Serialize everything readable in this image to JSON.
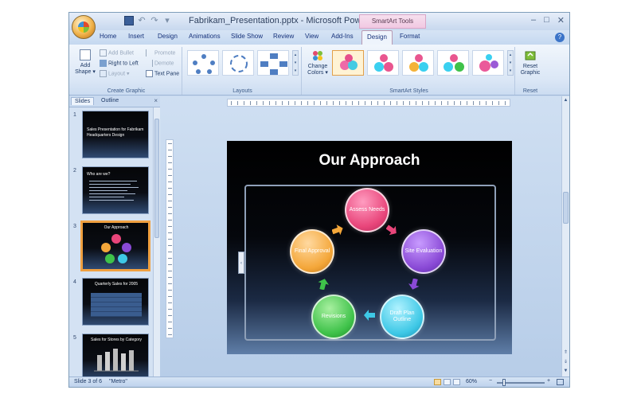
{
  "app": {
    "title": "Fabrikam_Presentation.pptx - Microsoft PowerPoint",
    "contextual_label": "SmartArt Tools"
  },
  "qat": {
    "undo": "↶",
    "redo": "↷",
    "more": "▾"
  },
  "window_controls": {
    "minimize": "–",
    "maximize": "□",
    "close": "✕"
  },
  "tabs": [
    {
      "label": "Home"
    },
    {
      "label": "Insert"
    },
    {
      "label": "Design"
    },
    {
      "label": "Animations"
    },
    {
      "label": "Slide Show"
    },
    {
      "label": "Review"
    },
    {
      "label": "View"
    },
    {
      "label": "Add-Ins"
    },
    {
      "label": "Design"
    },
    {
      "label": "Format"
    }
  ],
  "help": "?",
  "ribbon": {
    "create_graphic": {
      "label": "Create Graphic",
      "add_shape": "Add Shape ▾",
      "add_bullet": "Add Bullet",
      "right_to_left": "Right to Left",
      "layout": "Layout ▾",
      "promote": "Promote",
      "demote": "Demote",
      "text_pane": "Text Pane"
    },
    "layouts": {
      "label": "Layouts"
    },
    "smartart_styles": {
      "label": "SmartArt Styles",
      "change_colors": "Change Colors ▾"
    },
    "reset": {
      "label": "Reset",
      "reset_graphic": "Reset Graphic"
    }
  },
  "pane": {
    "tabs": [
      "Slides",
      "Outline"
    ],
    "close": "×",
    "slides": [
      {
        "num": "1",
        "title": "Sales Presentation for Fabrikam Headquarters Design"
      },
      {
        "num": "2",
        "title": "Who are we?"
      },
      {
        "num": "3",
        "title": "Our Approach"
      },
      {
        "num": "4",
        "title": "Quarterly Sales for 2005"
      },
      {
        "num": "5",
        "title": "Sales for Stores by Category"
      }
    ]
  },
  "slide": {
    "title": "Our Approach",
    "cycle": [
      {
        "label": "Assess Needs",
        "color": "#e8457a"
      },
      {
        "label": "Site Evaluation",
        "color": "#8a4ad6"
      },
      {
        "label": "Draft Plan Outline",
        "color": "#3ec8e6"
      },
      {
        "label": "Revisions",
        "color": "#3fc24a"
      },
      {
        "label": "Final Approval",
        "color": "#f4a73a"
      }
    ],
    "text_pane_toggle": "‹"
  },
  "status": {
    "slide_info": "Slide 3 of 6",
    "theme": "\"Metro\"",
    "zoom": "60%",
    "zoom_minus": "−",
    "zoom_plus": "+"
  },
  "colors": {
    "accent": "#f0a040",
    "ribbon_bg": "#dbe7f6",
    "contextual": "#f1c8e2"
  }
}
